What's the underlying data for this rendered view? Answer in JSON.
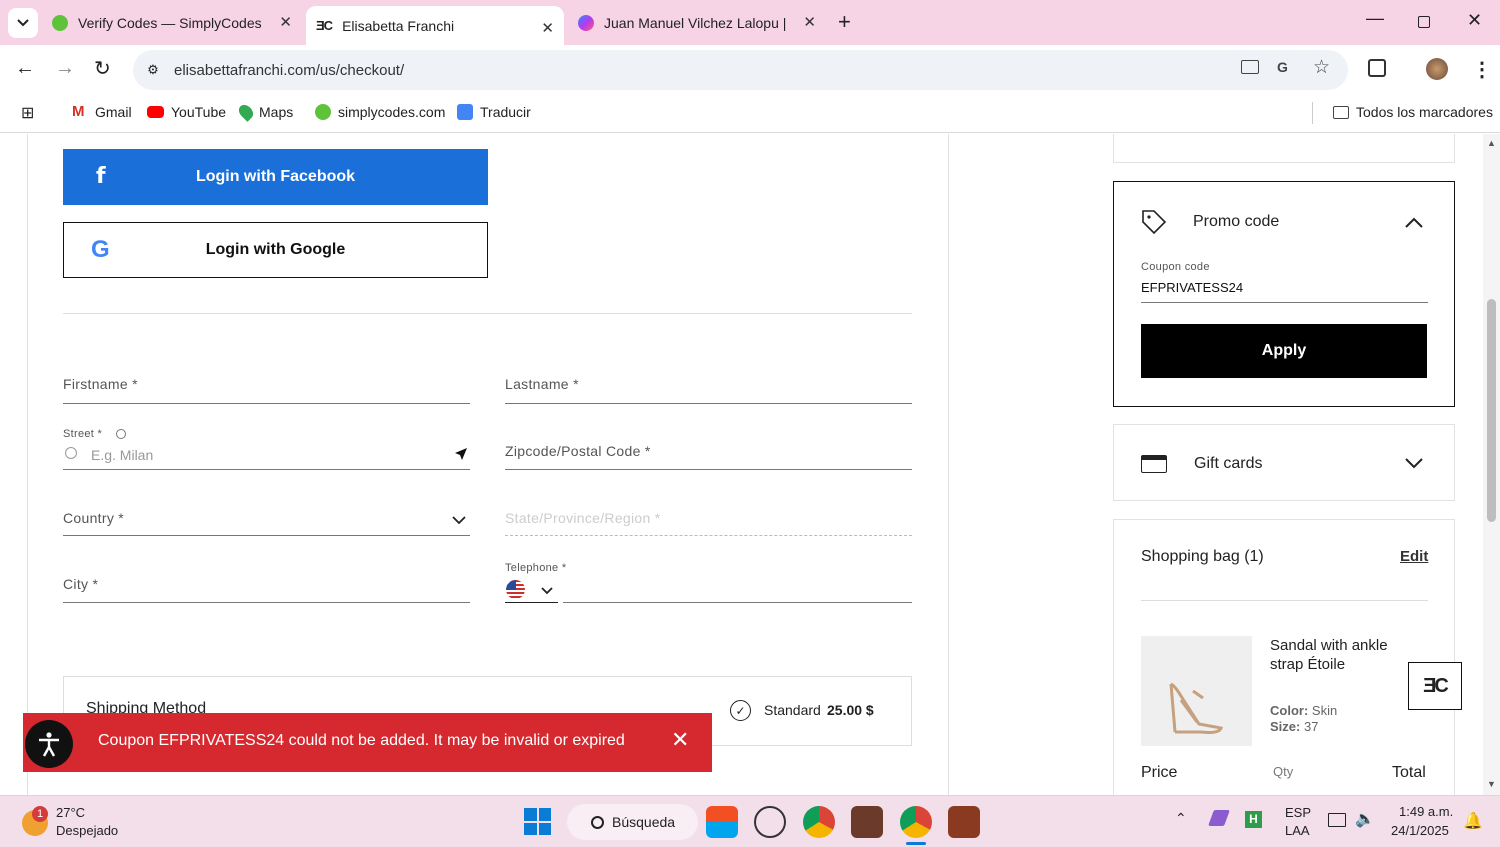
{
  "browser": {
    "tabs": [
      {
        "title": "Verify Codes — SimplyCodes",
        "favicon": "simplycodes-icon"
      },
      {
        "title": "Elisabetta Franchi",
        "favicon": "ef-logo-icon"
      },
      {
        "title": "Juan Manuel Vilchez Lalopu | M",
        "favicon": "messenger-icon"
      }
    ],
    "url": "elisabettafranchi.com/us/checkout/",
    "bookmarks": [
      "Gmail",
      "YouTube",
      "Maps",
      "simplycodes.com",
      "Traducir"
    ],
    "all_bookmarks": "Todos los marcadores"
  },
  "checkout": {
    "login_facebook": "Login with Facebook",
    "login_google": "Login with Google",
    "firstname": "Firstname *",
    "lastname": "Lastname *",
    "street_label": "Street *",
    "street_placeholder": "E.g. Milan",
    "zipcode": "Zipcode/Postal Code *",
    "country": "Country *",
    "state": "State/Province/Region *",
    "city": "City *",
    "telephone": "Telephone *",
    "shipping_method": "Shipping Method",
    "shipping_option": "Standard",
    "shipping_price": "25.00 $"
  },
  "toast": {
    "message": "Coupon EFPRIVATESS24 could not be added. It may be invalid or expired",
    "color": "#d6292f"
  },
  "sidebar": {
    "promo_title": "Promo code",
    "coupon_label": "Coupon code",
    "coupon_value": "EFPRIVATESS24",
    "apply": "Apply",
    "gift_cards": "Gift cards",
    "bag_title": "Shopping bag (1)",
    "edit": "Edit",
    "product_name": "Sandal with ankle strap Étoile",
    "color_label": "Color:",
    "color_value": "Skin",
    "size_label": "Size:",
    "size_value": "37",
    "price_label": "Price",
    "qty_label": "Qty",
    "total_label": "Total"
  },
  "taskbar": {
    "weather_temp": "27°C",
    "weather_desc": "Despejado",
    "weather_badge": "1",
    "search": "Búsqueda",
    "lang1": "ESP",
    "lang2": "LAA",
    "time": "1:49 a.m.",
    "date": "24/1/2025"
  }
}
